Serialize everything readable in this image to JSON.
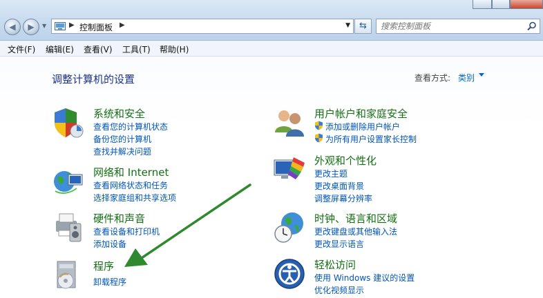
{
  "address": {
    "path": "控制面板"
  },
  "search": {
    "placeholder": "搜索控制面板"
  },
  "menu": {
    "file": "文件(F)",
    "edit": "编辑(E)",
    "view": "查看(V)",
    "tools": "工具(T)",
    "help": "帮助(H)"
  },
  "page": {
    "title": "调整计算机的设置",
    "view_label": "查看方式:",
    "view_value": "类别"
  },
  "categories": {
    "security": {
      "title": "系统和安全",
      "links": [
        "查看您的计算机状态",
        "备份您的计算机",
        "查找并解决问题"
      ]
    },
    "network": {
      "title": "网络和 Internet",
      "links": [
        "查看网络状态和任务",
        "选择家庭组和共享选项"
      ]
    },
    "hardware": {
      "title": "硬件和声音",
      "links": [
        "查看设备和打印机",
        "添加设备"
      ]
    },
    "programs": {
      "title": "程序",
      "links": [
        "卸载程序"
      ]
    },
    "users": {
      "title": "用户帐户和家庭安全",
      "links": [
        "添加或删除用户帐户",
        "为所有用户设置家长控制"
      ]
    },
    "appearance": {
      "title": "外观和个性化",
      "links": [
        "更改主题",
        "更改桌面背景",
        "调整屏幕分辨率"
      ]
    },
    "clock": {
      "title": "时钟、语言和区域",
      "links": [
        "更改键盘或其他输入法",
        "更改显示语言"
      ]
    },
    "ease": {
      "title": "轻松访问",
      "links": [
        "使用 Windows 建议的设置",
        "优化视频显示"
      ]
    }
  },
  "colors": {
    "title_green": "#127012",
    "link_blue": "#0055b8",
    "heading_blue": "#1e3287",
    "arrow_green": "#2f8a2f"
  },
  "icons": {
    "security": "shield-icon",
    "network": "globe-network-icon",
    "hardware": "printer-speaker-icon",
    "programs": "program-disc-icon",
    "users": "users-icon",
    "appearance": "paint-monitor-icon",
    "clock": "clock-globe-icon",
    "ease": "accessibility-icon"
  }
}
